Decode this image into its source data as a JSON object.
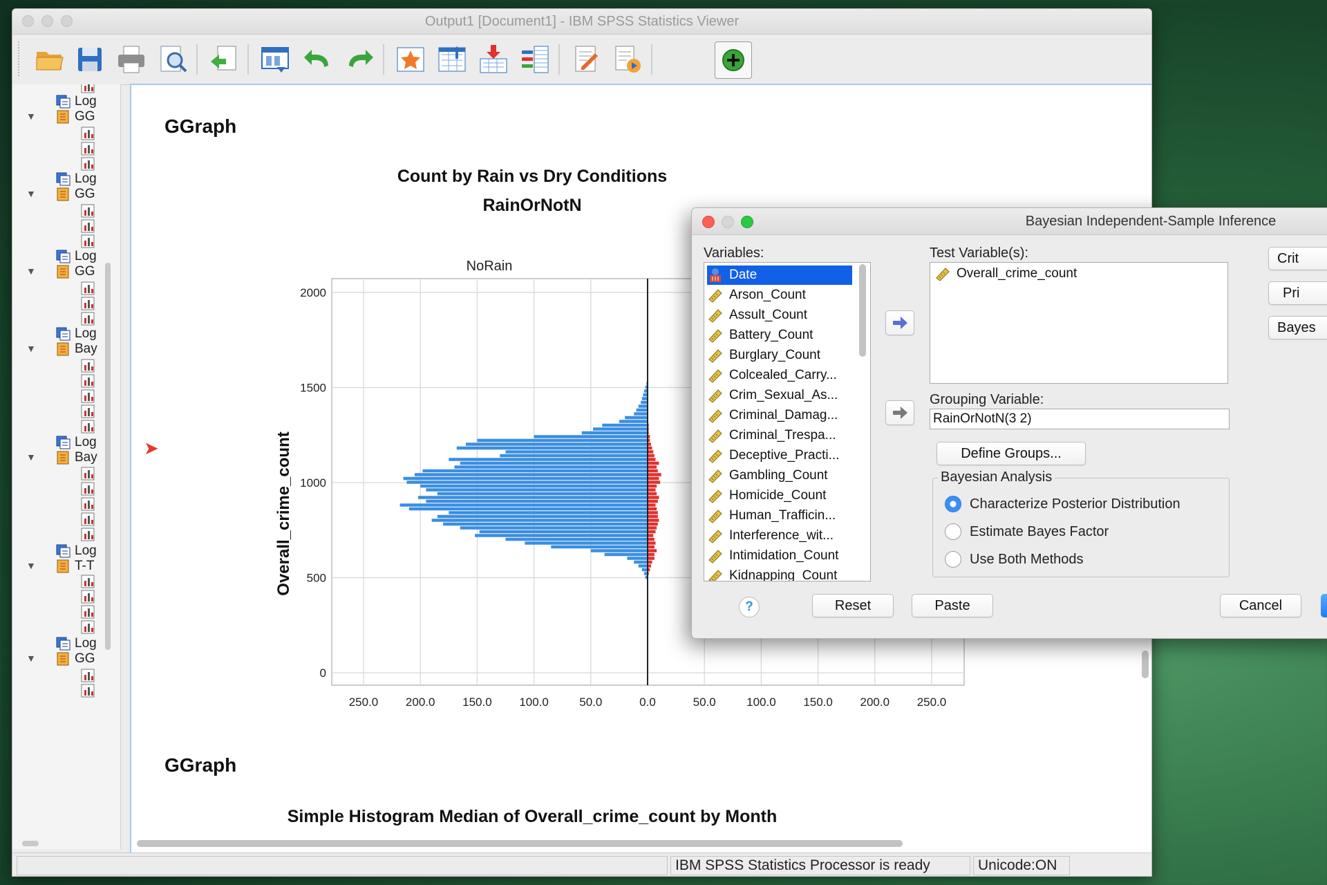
{
  "window": {
    "title": "Output1 [Document1] - IBM SPSS Statistics Viewer"
  },
  "toolbar": {
    "icons": [
      "open-icon",
      "save-icon",
      "print-icon",
      "print-preview-icon",
      "export-icon",
      "dialog-recall-icon",
      "undo-icon",
      "redo-icon",
      "goto-data-icon",
      "goto-case-icon",
      "goto-variable-icon",
      "variables-icon",
      "designate-window-icon",
      "run-script-icon",
      "add-extension-icon"
    ]
  },
  "outline": {
    "items": [
      "Log",
      "GG",
      "Log",
      "GG",
      "Log",
      "GG",
      "Log",
      "Bay",
      "Log",
      "Bay",
      "Log",
      "T-T",
      "Log",
      "GG"
    ]
  },
  "output": {
    "heading1": "GGraph",
    "heading2": "GGraph",
    "chart_title": "Count by Rain vs Dry Conditions",
    "chart_subtitle": "RainOrNotN",
    "next_chart_title": "Simple Histogram Median of Overall_crime_count by Month"
  },
  "chart_data": {
    "type": "bar",
    "orientation": "horizontal-population-pyramid",
    "title": "Count by Rain vs Dry Conditions",
    "panel_label": "RainOrNotN",
    "left_panel": "NoRain",
    "ylabel": "Overall_crime_count",
    "ylim": [
      0,
      2000
    ],
    "y_ticks": [
      "0",
      "500",
      "1000",
      "1500",
      "2000"
    ],
    "x_ticks": [
      "250.0",
      "200.0",
      "150.0",
      "100.0",
      "50.0",
      "0.0",
      "50.0",
      "100.0",
      "150.0",
      "200.0",
      "250.0"
    ],
    "bin_centers": [
      500,
      520,
      540,
      560,
      580,
      600,
      620,
      640,
      660,
      680,
      700,
      720,
      740,
      760,
      780,
      800,
      820,
      840,
      860,
      880,
      900,
      920,
      940,
      960,
      980,
      1000,
      1020,
      1040,
      1060,
      1080,
      1100,
      1120,
      1140,
      1160,
      1180,
      1200,
      1220,
      1240,
      1260,
      1280,
      1300,
      1320,
      1340,
      1360,
      1380,
      1400,
      1420,
      1440,
      1460,
      1480,
      1500,
      1520
    ],
    "series": [
      {
        "values": [
          2,
          3,
          5,
          8,
          12,
          18,
          38,
          50,
          85,
          108,
          125,
          152,
          148,
          165,
          180,
          190,
          185,
          175,
          210,
          218,
          195,
          202,
          185,
          195,
          200,
          212,
          215,
          205,
          198,
          170,
          165,
          175,
          130,
          125,
          168,
          160,
          150,
          100,
          58,
          48,
          40,
          25,
          20,
          12,
          10,
          8,
          6,
          5,
          4,
          3,
          2,
          1
        ]
      },
      {
        "values": [
          0,
          1,
          2,
          3,
          4,
          6,
          6,
          8,
          6,
          7,
          6,
          5,
          7,
          8,
          9,
          10,
          9,
          9,
          8,
          7,
          9,
          10,
          8,
          7,
          8,
          11,
          10,
          12,
          9,
          8,
          10,
          7,
          6,
          5,
          4,
          3,
          2,
          2,
          1,
          1,
          1,
          0,
          0,
          0,
          0,
          0,
          0,
          0,
          0,
          0,
          0,
          0
        ]
      }
    ],
    "colors": {
      "NoRain": "#3a8ee2",
      "Rain": "#e23030"
    }
  },
  "dialog": {
    "title": "Bayesian Independent-Sample Inference",
    "variables_label": "Variables:",
    "variables": [
      "Date",
      "Arson_Count",
      "Assult_Count",
      "Battery_Count",
      "Burglary_Count",
      "Colcealed_Carry...",
      "Crim_Sexual_As...",
      "Criminal_Damag...",
      "Criminal_Trespa...",
      "Deceptive_Practi...",
      "Gambling_Count",
      "Homicide_Count",
      "Human_Trafficin...",
      "Interference_wit...",
      "Intimidation_Count",
      "Kidnapping_Count"
    ],
    "test_label": "Test Variable(s):",
    "test_variables": [
      "Overall_crime_count"
    ],
    "grouping_label": "Grouping Variable:",
    "grouping_value": "RainOrNotN(3 2)",
    "define_groups": "Define Groups...",
    "analysis_title": "Bayesian Analysis",
    "radio_options": [
      "Characterize Posterior Distribution",
      "Estimate Bayes Factor",
      "Use Both Methods"
    ],
    "side_buttons": [
      "Crit",
      "Pri",
      "Bayes"
    ],
    "help": "?",
    "reset": "Reset",
    "paste": "Paste",
    "cancel": "Cancel"
  },
  "status": {
    "message": "IBM SPSS Statistics Processor is ready",
    "encoding": "Unicode:ON"
  }
}
